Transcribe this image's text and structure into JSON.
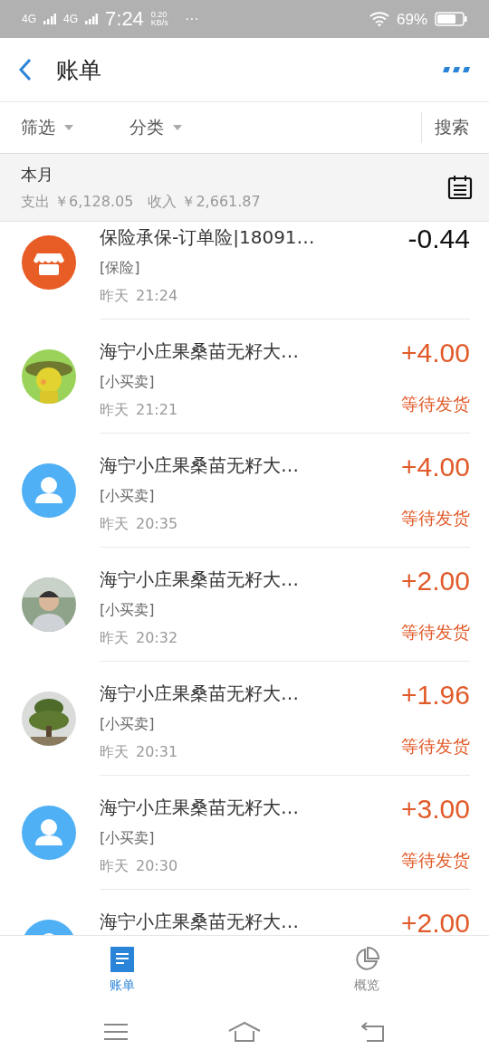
{
  "status_bar": {
    "network_1": "4G",
    "network_2": "4G",
    "time": "7:24",
    "speed_value": "0.20",
    "speed_unit": "KB/s",
    "more": "···",
    "battery": "69%"
  },
  "header": {
    "title": "账单"
  },
  "filters": [
    {
      "label": "筛选"
    },
    {
      "label": "分类"
    }
  ],
  "search": "搜索",
  "month": {
    "title": "本月",
    "expense_label": "支出",
    "expense": "￥6,128.05",
    "income_label": "收入",
    "income": "￥2,661.87"
  },
  "transactions": [
    {
      "kind": "shop",
      "title": "保险承保-订单险|18091…",
      "category": "[保险]",
      "day": "昨天",
      "time": "21:24",
      "amount": "-0.44",
      "color": "#111111"
    },
    {
      "kind": "picture",
      "title": "海宁小庄果桑苗无籽大…",
      "category": "[小买卖]",
      "day": "昨天",
      "time": "21:21",
      "amount": "+4.00",
      "color": "#e15b2a",
      "status": "等待发货"
    },
    {
      "kind": "person",
      "title": "海宁小庄果桑苗无籽大…",
      "category": "[小买卖]",
      "day": "昨天",
      "time": "20:35",
      "amount": "+4.00",
      "color": "#e15b2a",
      "status": "等待发货"
    },
    {
      "kind": "picture",
      "title": "海宁小庄果桑苗无籽大…",
      "category": "[小买卖]",
      "day": "昨天",
      "time": "20:32",
      "amount": "+2.00",
      "color": "#e15b2a",
      "status": "等待发货"
    },
    {
      "kind": "picture",
      "title": "海宁小庄果桑苗无籽大…",
      "category": "[小买卖]",
      "day": "昨天",
      "time": "20:31",
      "amount": "+1.96",
      "color": "#e15b2a",
      "status": "等待发货"
    },
    {
      "kind": "person",
      "title": "海宁小庄果桑苗无籽大…",
      "category": "[小买卖]",
      "day": "昨天",
      "time": "20:30",
      "amount": "+3.00",
      "color": "#e15b2a",
      "status": "等待发货"
    },
    {
      "kind": "person",
      "title": "海宁小庄果桑苗无籽大…",
      "amount": "+2.00",
      "color": "#e15b2a"
    }
  ],
  "tabs": [
    {
      "label": "账单",
      "selected": true
    },
    {
      "label": "概览",
      "selected": false
    }
  ]
}
